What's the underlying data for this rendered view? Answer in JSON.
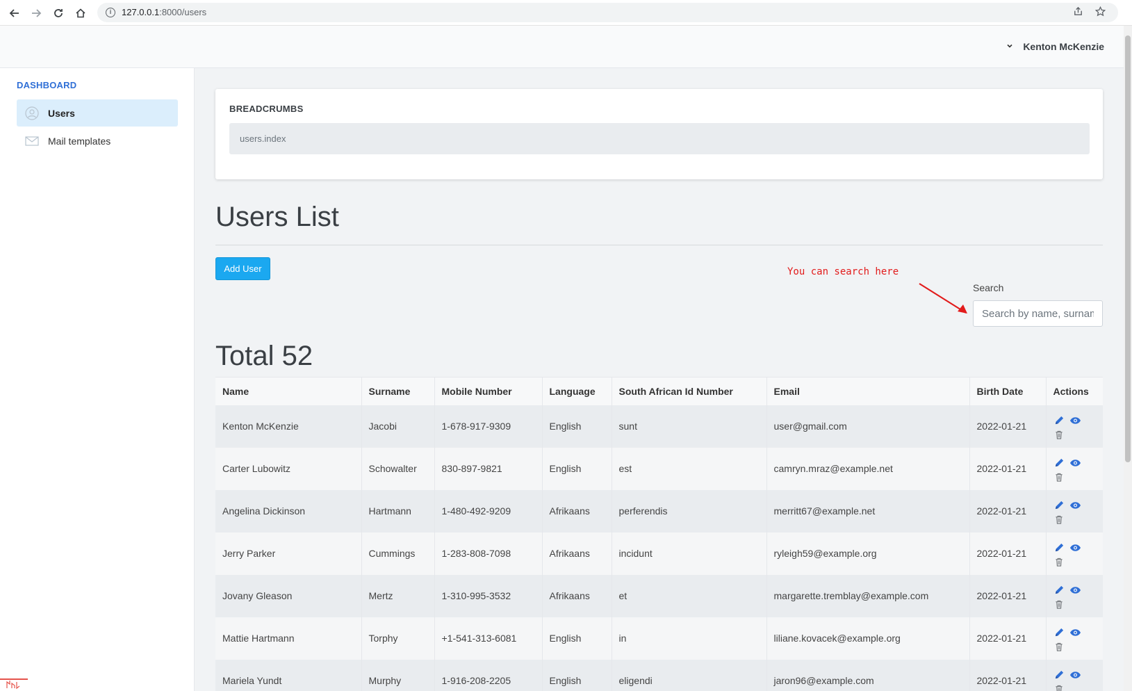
{
  "browser": {
    "url_host": "127.0.0.1",
    "url_path": ":8000/users"
  },
  "header": {
    "user_name": "Kenton McKenzie"
  },
  "sidebar": {
    "title": "DASHBOARD",
    "items": [
      {
        "label": "Users",
        "icon": "user-icon",
        "active": true
      },
      {
        "label": "Mail templates",
        "icon": "envelope-icon",
        "active": false
      }
    ]
  },
  "breadcrumbs": {
    "title": "BREADCRUMBS",
    "path": "users.index"
  },
  "main": {
    "title": "Users List",
    "add_button_label": "Add User",
    "annotation": "You can search here",
    "search_label": "Search",
    "search_placeholder": "Search by name, surname",
    "total_label": "Total 52"
  },
  "table": {
    "columns": [
      "Name",
      "Surname",
      "Mobile Number",
      "Language",
      "South African Id Number",
      "Email",
      "Birth Date",
      "Actions"
    ],
    "rows": [
      [
        "Kenton McKenzie",
        "Jacobi",
        "1-678-917-9309",
        "English",
        "sunt",
        "user@gmail.com",
        "2022-01-21"
      ],
      [
        "Carter Lubowitz",
        "Schowalter",
        "830-897-9821",
        "English",
        "est",
        "camryn.mraz@example.net",
        "2022-01-21"
      ],
      [
        "Angelina Dickinson",
        "Hartmann",
        "1-480-492-9209",
        "Afrikaans",
        "perferendis",
        "merritt67@example.net",
        "2022-01-21"
      ],
      [
        "Jerry Parker",
        "Cummings",
        "1-283-808-7098",
        "Afrikaans",
        "incidunt",
        "ryleigh59@example.org",
        "2022-01-21"
      ],
      [
        "Jovany Gleason",
        "Mertz",
        "1-310-995-3532",
        "Afrikaans",
        "et",
        "margarette.tremblay@example.com",
        "2022-01-21"
      ],
      [
        "Mattie Hartmann",
        "Torphy",
        "+1-541-313-6081",
        "English",
        "in",
        "liliane.kovacek@example.org",
        "2022-01-21"
      ],
      [
        "Mariela Yundt",
        "Murphy",
        "1-916-208-2205",
        "English",
        "eligendi",
        "jaron96@example.com",
        "2022-01-21"
      ]
    ],
    "action_icons": [
      "pencil-icon",
      "eye-icon",
      "trash-icon"
    ]
  },
  "colors": {
    "accent_blue": "#2f6fd6",
    "button_blue": "#1ba8f0",
    "annotation_red": "#e21b1b",
    "active_sidebar": "#dbeefc"
  }
}
